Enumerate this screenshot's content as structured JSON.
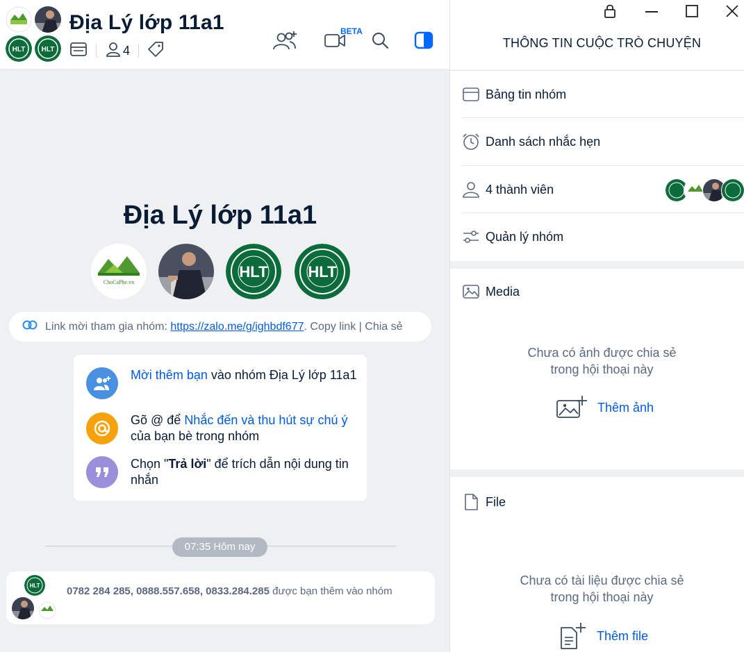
{
  "header": {
    "title": "Địa Lý lớp 11a1",
    "member_count": "4",
    "beta_label": "BETA"
  },
  "intro": {
    "title": "Địa Lý lớp 11a1"
  },
  "invite": {
    "prefix": "Link mời tham gia nhóm:",
    "link": "https://zalo.me/g/ighbdf677",
    "dot": ".",
    "copy": "Copy link",
    "divider": "|",
    "share": "Chia sẻ"
  },
  "tips": {
    "t1_link": "Mời thêm bạn",
    "t1_rest": " vào nhóm Địa Lý lớp 11a1",
    "t2_pre": "Gõ @ để ",
    "t2_link": "Nhắc đến và thu hút sự chú ý",
    "t2_rest": " của bạn bè trong nhóm",
    "t3_pre": "Chọn \"",
    "t3_bold": "Trả lời",
    "t3_rest": "\" để trích dẫn nội dung tin nhắn"
  },
  "timestamp": "07:35 Hôm nay",
  "system_message": {
    "names": "0782 284 285, 0888.557.658, 0833.284.285",
    "rest": " được bạn thêm vào nhóm"
  },
  "right_panel": {
    "title": "THÔNG TIN CUỘC TRÒ CHUYỆN",
    "items": [
      {
        "label": "Bảng tin nhóm"
      },
      {
        "label": "Danh sách nhắc hẹn"
      },
      {
        "label": "4 thành viên"
      },
      {
        "label": "Quản lý nhóm"
      }
    ],
    "media": {
      "title": "Media",
      "empty_line1": "Chưa có ảnh được chia sẻ",
      "empty_line2": "trong hội thoại này",
      "add_label": "Thêm ảnh"
    },
    "file": {
      "title": "File",
      "empty_line1": "Chưa có tài liệu được chia sẻ",
      "empty_line2": "trong hội thoại này",
      "add_label": "Thêm file"
    }
  },
  "avatars": {
    "chocaphe_text": "ChoCaPhe.vn",
    "hlt_text": "HLT"
  },
  "colors": {
    "accent": "#005ae0",
    "panel_bg": "#eef0f1",
    "hlt_green": "#0b6b3a",
    "tip_invite": "#4a90e2",
    "tip_mention": "#f5a20d",
    "tip_quote": "#9b8edb"
  }
}
